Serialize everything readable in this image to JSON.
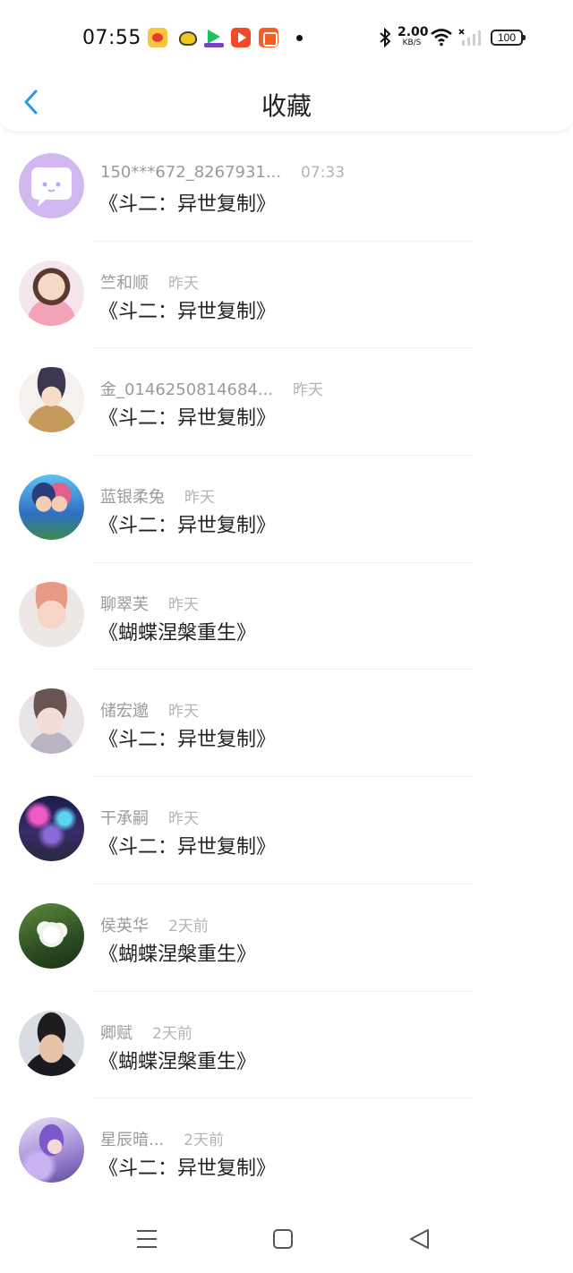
{
  "status_bar": {
    "time": "07:55",
    "net_speed_value": "2.00",
    "net_speed_unit": "KB/S",
    "battery": "100",
    "notification_icons": [
      "weibo-icon",
      "bee-app-icon",
      "iqiyi-icon",
      "video-app-icon",
      "kuaishou-icon"
    ]
  },
  "header": {
    "title": "收藏",
    "back_icon": "chevron-left-icon"
  },
  "colors": {
    "accent": "#2a98e8",
    "text_primary": "#222222",
    "text_secondary": "#9a9a9a",
    "text_time": "#b4b4b4"
  },
  "list": {
    "items": [
      {
        "name": "150***672_8267931...",
        "time": "07:33",
        "content": "《斗二：异世复制》",
        "avatar": "chat-bubble-avatar"
      },
      {
        "name": "竺和顺",
        "time": "昨天",
        "content": "《斗二：异世复制》",
        "avatar": "girl-photo-avatar"
      },
      {
        "name": "金_0146250814684...",
        "time": "昨天",
        "content": "《斗二：异世复制》",
        "avatar": "anime-character-avatar"
      },
      {
        "name": "蓝银柔兔",
        "time": "昨天",
        "content": "《斗二：异世复制》",
        "avatar": "anime-couple-avatar"
      },
      {
        "name": "聊翠芙",
        "time": "昨天",
        "content": "《蝴蝶涅槃重生》",
        "avatar": "girl-selfie-avatar"
      },
      {
        "name": "储宏邈",
        "time": "昨天",
        "content": "《斗二：异世复制》",
        "avatar": "girl-filter-avatar"
      },
      {
        "name": "干承嗣",
        "time": "昨天",
        "content": "《斗二：异世复制》",
        "avatar": "night-lights-avatar"
      },
      {
        "name": "侯英华",
        "time": "2天前",
        "content": "《蝴蝶涅槃重生》",
        "avatar": "white-flower-avatar"
      },
      {
        "name": "卿赋",
        "time": "2天前",
        "content": "《蝴蝶涅槃重生》",
        "avatar": "boy-photo-avatar"
      },
      {
        "name": "星辰暗...",
        "time": "2天前",
        "content": "《斗二：异世复制》",
        "avatar": "fantasy-art-avatar"
      }
    ]
  },
  "nav_bar": {
    "buttons": [
      "menu-icon",
      "home-icon",
      "back-triangle-icon"
    ]
  }
}
